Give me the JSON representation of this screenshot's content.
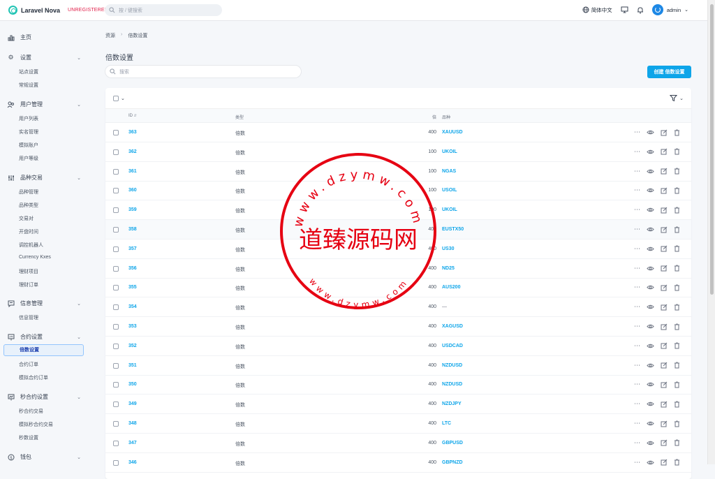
{
  "app": {
    "name": "Laravel Nova",
    "unregistered": "UNREGISTERED"
  },
  "global_search": {
    "placeholder": "按 / 键搜索"
  },
  "topbar": {
    "language": "简体中文",
    "user": "admin"
  },
  "sidebar": {
    "home": "主页",
    "settings": {
      "label": "设置",
      "items": [
        "站点设置",
        "常规设置"
      ]
    },
    "users": {
      "label": "用户管理",
      "items": [
        "用户列表",
        "实名管理",
        "模拟账户",
        "用户等级"
      ]
    },
    "trading": {
      "label": "品种交易",
      "items": [
        "品种管理",
        "品种类型",
        "交易对",
        "开盘时间",
        "调控机器人",
        "Currency Kxes",
        "理财项目",
        "理财订单"
      ]
    },
    "info": {
      "label": "信息管理",
      "items": [
        "信息管理"
      ]
    },
    "contract": {
      "label": "合约设置",
      "items": [
        "倍数设置",
        "合约订单",
        "模拟合约订单"
      ],
      "active": "倍数设置"
    },
    "seconds": {
      "label": "秒合约设置",
      "items": [
        "秒合约交易",
        "模拟秒合约交易",
        "秒数设置"
      ]
    },
    "wallet": {
      "label": "钱包"
    }
  },
  "breadcrumb": {
    "root": "资源",
    "current": "倍数设置"
  },
  "page": {
    "title": "倍数设置",
    "search_placeholder": "搜索",
    "create_button": "创建 倍数设置"
  },
  "table": {
    "headers": {
      "id": "ID",
      "type": "类型",
      "multiplier": "倍",
      "variety": "品种"
    },
    "rows": [
      {
        "id": "363",
        "type": "倍数",
        "multiplier": "400",
        "variety": "XAUUSD"
      },
      {
        "id": "362",
        "type": "倍数",
        "multiplier": "100",
        "variety": "UKOIL"
      },
      {
        "id": "361",
        "type": "倍数",
        "multiplier": "100",
        "variety": "NGAS"
      },
      {
        "id": "360",
        "type": "倍数",
        "multiplier": "100",
        "variety": "USOIL"
      },
      {
        "id": "359",
        "type": "倍数",
        "multiplier": "100",
        "variety": "UKOIL"
      },
      {
        "id": "358",
        "type": "倍数",
        "multiplier": "400",
        "variety": "EUSTX50"
      },
      {
        "id": "357",
        "type": "倍数",
        "multiplier": "400",
        "variety": "US30"
      },
      {
        "id": "356",
        "type": "倍数",
        "multiplier": "400",
        "variety": "ND25"
      },
      {
        "id": "355",
        "type": "倍数",
        "multiplier": "400",
        "variety": "AUS200"
      },
      {
        "id": "354",
        "type": "倍数",
        "multiplier": "400",
        "variety": "—"
      },
      {
        "id": "353",
        "type": "倍数",
        "multiplier": "400",
        "variety": "XAGUSD"
      },
      {
        "id": "352",
        "type": "倍数",
        "multiplier": "400",
        "variety": "USDCAD"
      },
      {
        "id": "351",
        "type": "倍数",
        "multiplier": "400",
        "variety": "NZDUSD"
      },
      {
        "id": "350",
        "type": "倍数",
        "multiplier": "400",
        "variety": "NZDUSD"
      },
      {
        "id": "349",
        "type": "倍数",
        "multiplier": "400",
        "variety": "NZDJPY"
      },
      {
        "id": "348",
        "type": "倍数",
        "multiplier": "400",
        "variety": "LTC"
      },
      {
        "id": "347",
        "type": "倍数",
        "multiplier": "400",
        "variety": "GBPUSD"
      },
      {
        "id": "346",
        "type": "倍数",
        "multiplier": "400",
        "variety": "GBPNZD"
      }
    ]
  },
  "watermark": {
    "text": "道臻源码网",
    "ring_top": "www.dzymw.com",
    "ring_bottom": "www.dzymw.com"
  },
  "colors": {
    "accent": "#0ea5e9",
    "unregistered": "#e11d48",
    "stamp": "#e60012"
  }
}
